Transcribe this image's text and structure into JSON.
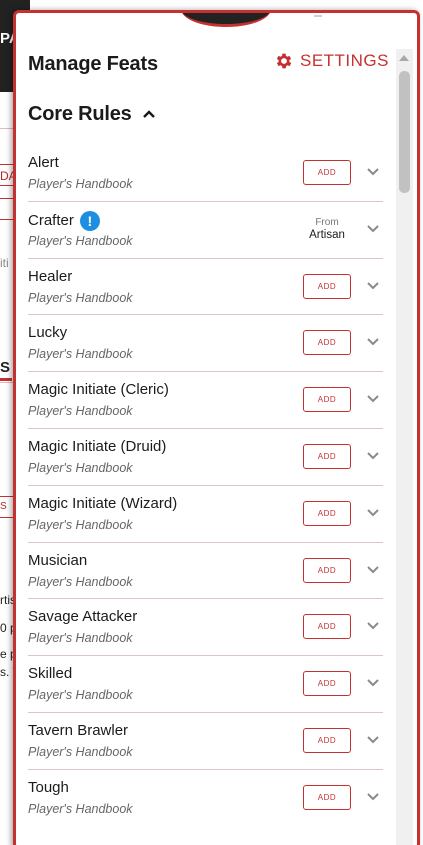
{
  "background": {
    "title": "PA",
    "snips": [
      "DA",
      "iti",
      "S",
      "S",
      "rtis",
      "0 p",
      "e p",
      "s. T"
    ]
  },
  "panel": {
    "title": "Manage Feats",
    "settings_label": "SETTINGS",
    "settings_icon": "gear-icon",
    "section_title": "Core Rules",
    "section_icon": "chevron-up-icon"
  },
  "colors": {
    "accent": "#c53131",
    "warning": "#1e8fe0",
    "text": "#1b1b1b",
    "source": "#666666"
  },
  "feats": [
    {
      "name": "Alert",
      "source": "Player's Handbook",
      "action": "ADD"
    },
    {
      "name": "Crafter",
      "source": "Player's Handbook",
      "warning": "!",
      "from_label": "From",
      "from_value": "Artisan"
    },
    {
      "name": "Healer",
      "source": "Player's Handbook",
      "action": "ADD"
    },
    {
      "name": "Lucky",
      "source": "Player's Handbook",
      "action": "ADD"
    },
    {
      "name": "Magic Initiate (Cleric)",
      "source": "Player's Handbook",
      "action": "ADD"
    },
    {
      "name": "Magic Initiate (Druid)",
      "source": "Player's Handbook",
      "action": "ADD"
    },
    {
      "name": "Magic Initiate (Wizard)",
      "source": "Player's Handbook",
      "action": "ADD"
    },
    {
      "name": "Musician",
      "source": "Player's Handbook",
      "action": "ADD"
    },
    {
      "name": "Savage Attacker",
      "source": "Player's Handbook",
      "action": "ADD"
    },
    {
      "name": "Skilled",
      "source": "Player's Handbook",
      "action": "ADD"
    },
    {
      "name": "Tavern Brawler",
      "source": "Player's Handbook",
      "action": "ADD"
    },
    {
      "name": "Tough",
      "source": "Player's Handbook",
      "action": "ADD"
    }
  ]
}
